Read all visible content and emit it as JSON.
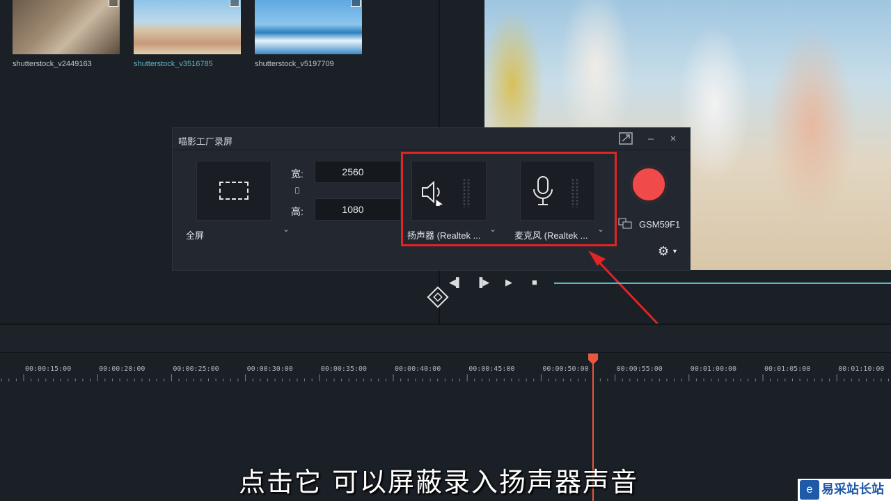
{
  "media": {
    "items": [
      {
        "label": "shutterstock_v2449163",
        "active": false
      },
      {
        "label": "shutterstock_v3516785",
        "active": true
      },
      {
        "label": "shutterstock_v5197709",
        "active": false
      }
    ]
  },
  "recorder": {
    "title": "喵影工厂录屏",
    "mode_label": "全屏",
    "width_label": "宽:",
    "width_value": "2560",
    "height_label": "高:",
    "height_value": "1080",
    "speaker_label": "扬声器 (Realtek ...",
    "mic_label": "麦克风 (Realtek ...",
    "monitor_label": "GSM59F1"
  },
  "timeline": {
    "ticks": [
      "00:00:15:00",
      "00:00:20:00",
      "00:00:25:00",
      "00:00:30:00",
      "00:00:35:00",
      "00:00:40:00",
      "00:00:45:00",
      "00:00:50:00",
      "00:00:55:00",
      "00:01:00:00",
      "00:01:05:00",
      "00:01:10:00"
    ]
  },
  "subtitle": "点击它  可以屏蔽录入扬声器声音",
  "watermark": {
    "text": "易采站长站"
  },
  "colors": {
    "accent": "#59b9c1",
    "record": "#f04a4a",
    "highlight": "#e12424",
    "playhead": "#e8583e"
  }
}
